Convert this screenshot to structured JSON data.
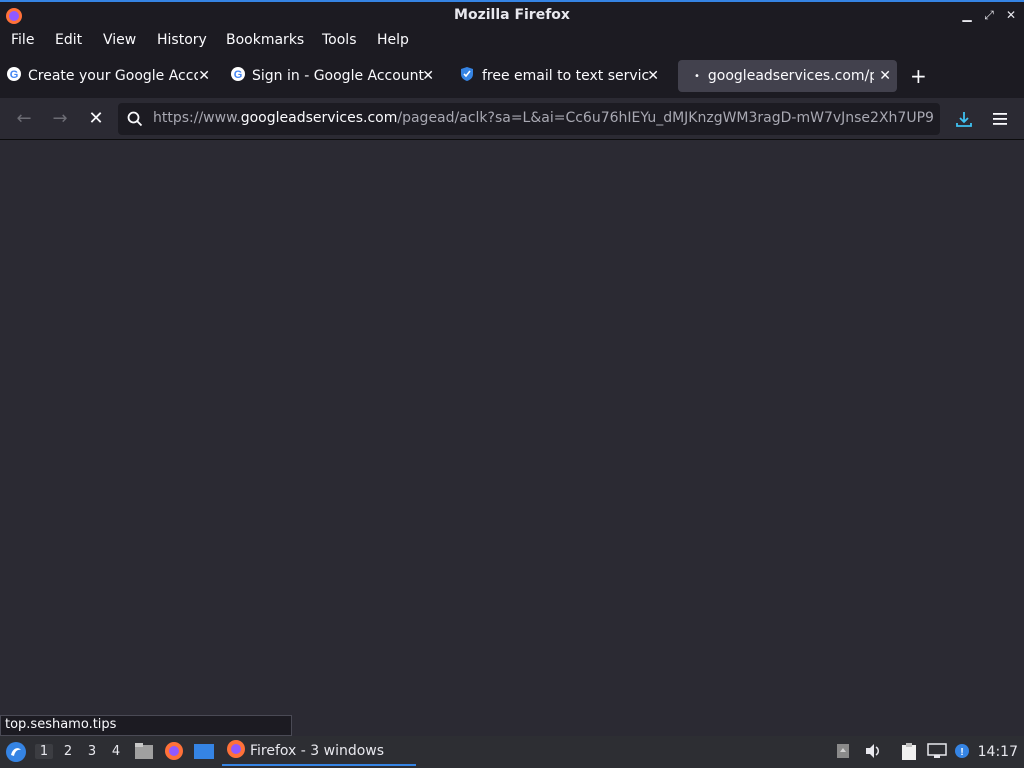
{
  "window": {
    "title": "Mozilla Firefox"
  },
  "menu": [
    "File",
    "Edit",
    "View",
    "History",
    "Bookmarks",
    "Tools",
    "Help"
  ],
  "tabs": [
    {
      "label": "Create your Google Acco",
      "icon": "google-icon"
    },
    {
      "label": "Sign in - Google Accounts",
      "icon": "google-icon"
    },
    {
      "label": "free email to text service",
      "icon": "shield-check-icon"
    },
    {
      "label": "googleadservices.com/p",
      "icon": "loading-dot-icon",
      "active": true
    }
  ],
  "nav": {
    "url_prefix": "https://www.",
    "url_host": "googleadservices.com",
    "url_rest": "/pagead/aclk?sa=L&ai=Cc6u76hIEYu_dMJKnzgWM3ragD-mW7vJnse2Xh7UP9"
  },
  "status": {
    "text": "top.seshamo.tips"
  },
  "taskbar": {
    "workspaces": [
      "1",
      "2",
      "3",
      "4"
    ],
    "task_label": "Firefox - 3 windows",
    "clock": "14:17"
  },
  "colors": {
    "accent": "#3584e4",
    "chrome": "#1c1b22",
    "content": "#2b2a33"
  }
}
